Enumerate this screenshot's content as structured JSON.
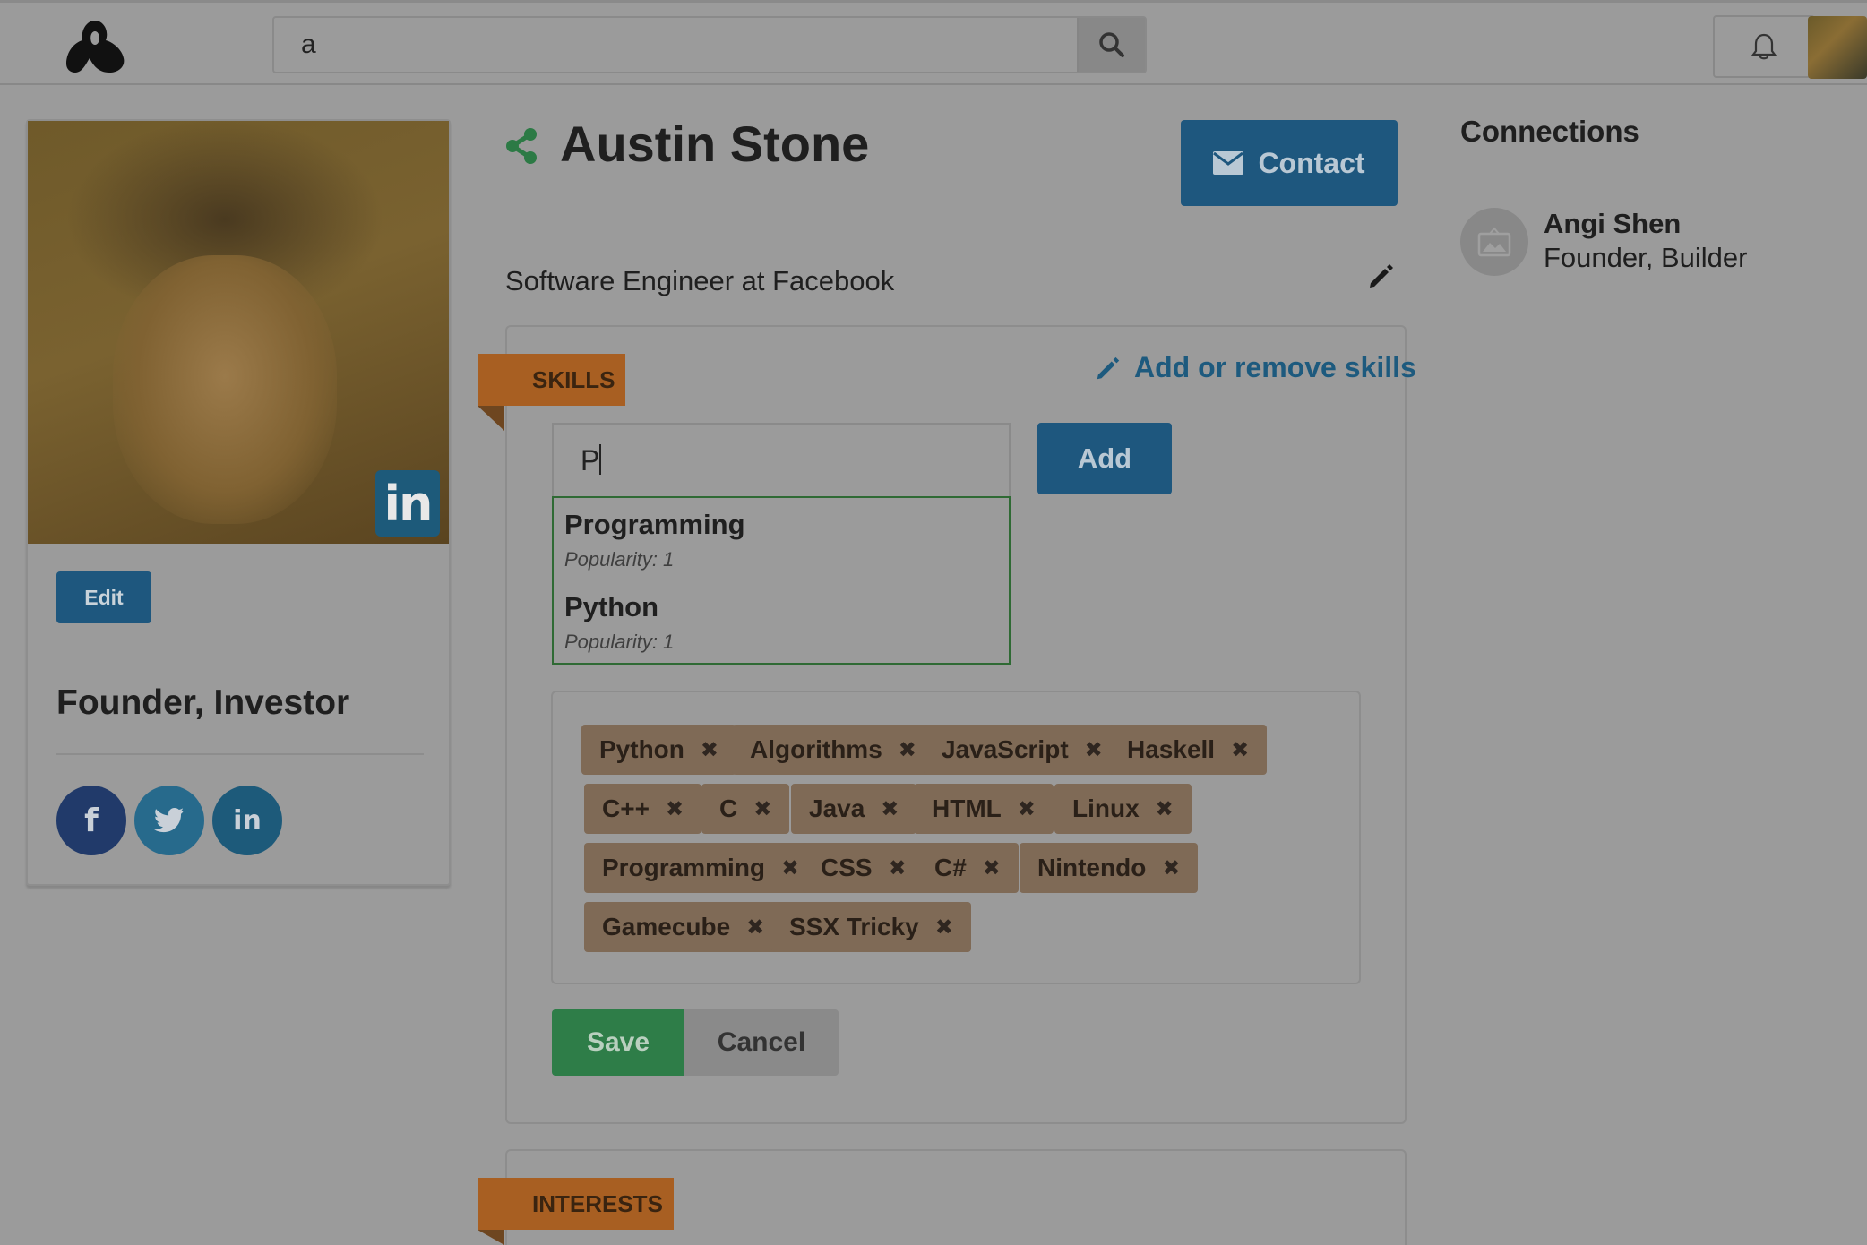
{
  "header": {
    "search_value": "a"
  },
  "profile": {
    "edit_label": "Edit",
    "title": "Founder, Investor",
    "linkedin_badge": "in",
    "social": {
      "facebook": "f",
      "linkedin": "in"
    }
  },
  "main": {
    "name": "Austin Stone",
    "contact_label": "Contact",
    "headline": "Software Engineer at Facebook",
    "skills": {
      "section_label": "SKILLS",
      "add_remove_label": "Add or remove skills",
      "input_value": "P",
      "add_label": "Add",
      "suggestions": [
        {
          "name": "Programming",
          "popularity": "Popularity: 1"
        },
        {
          "name": "Python",
          "popularity": "Popularity: 1"
        }
      ],
      "tags": [
        "Python",
        "Algorithms",
        "JavaScript",
        "Haskell",
        "C++",
        "C",
        "Java",
        "HTML",
        "Linux",
        "Programming",
        "CSS",
        "C#",
        "Nintendo",
        "Gamecube",
        "SSX Tricky"
      ],
      "remove_glyph": "✖",
      "save_label": "Save",
      "cancel_label": "Cancel"
    },
    "interests": {
      "section_label": "INTERESTS"
    }
  },
  "connections": {
    "title": "Connections",
    "items": [
      {
        "name": "Angi Shen",
        "role": "Founder, Builder"
      }
    ]
  },
  "colors": {
    "accent_blue": "#1e577e",
    "ribbon_orange": "#a85f22",
    "save_green": "#2e7d48",
    "tag_brown": "#7f6a56"
  }
}
